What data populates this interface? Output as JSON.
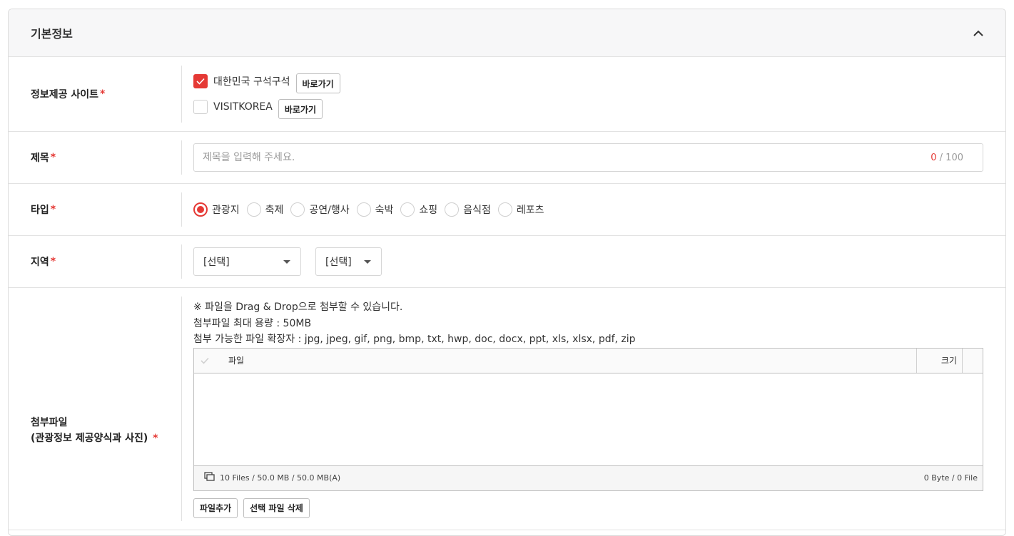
{
  "panel": {
    "title": "기본정보",
    "collapse_icon": "chevron-up-icon"
  },
  "site_row": {
    "label": "정보제공 사이트",
    "required_mark": "*",
    "sites": [
      {
        "name": "대한민국 구석구석",
        "checked": true,
        "link_label": "바로가기"
      },
      {
        "name": "VISITKOREA",
        "checked": false,
        "link_label": "바로가기"
      }
    ]
  },
  "title_row": {
    "label": "제목",
    "required_mark": "*",
    "placeholder": "제목을 입력해 주세요.",
    "value": "",
    "count_current": "0",
    "count_max": "/ 100"
  },
  "type_row": {
    "label": "타입",
    "required_mark": "*",
    "options": [
      {
        "label": "관광지",
        "selected": true
      },
      {
        "label": "축제",
        "selected": false
      },
      {
        "label": "공연/행사",
        "selected": false
      },
      {
        "label": "숙박",
        "selected": false
      },
      {
        "label": "쇼핑",
        "selected": false
      },
      {
        "label": "음식점",
        "selected": false
      },
      {
        "label": "레포츠",
        "selected": false
      }
    ]
  },
  "area_row": {
    "label": "지역",
    "required_mark": "*",
    "select1_value": "[선택]",
    "select2_value": "[선택]"
  },
  "file_row": {
    "label_line1": "첨부파일",
    "label_line2": "(관광정보 제공양식과 사진)",
    "required_mark": "*",
    "notes": [
      "※ 파일을 Drag & Drop으로 첨부할 수 있습니다.",
      "첨부파일 최대 용량 : 50MB",
      "첨부 가능한 파일 확장자 : jpg, jpeg, gif, png, bmp, txt, hwp, doc, docx, ppt, xls, xlsx, pdf, zip"
    ],
    "table": {
      "col_file": "파일",
      "col_size": "크기",
      "footer_left": "10 Files / 50.0 MB / 50.0 MB(A)",
      "footer_right": "0 Byte / 0 File"
    },
    "add_button": "파일추가",
    "delete_button": "선택 파일 삭제"
  },
  "colors": {
    "accent": "#e53935",
    "border": "#e2e2e2",
    "header_bg": "#f7f7f8"
  }
}
